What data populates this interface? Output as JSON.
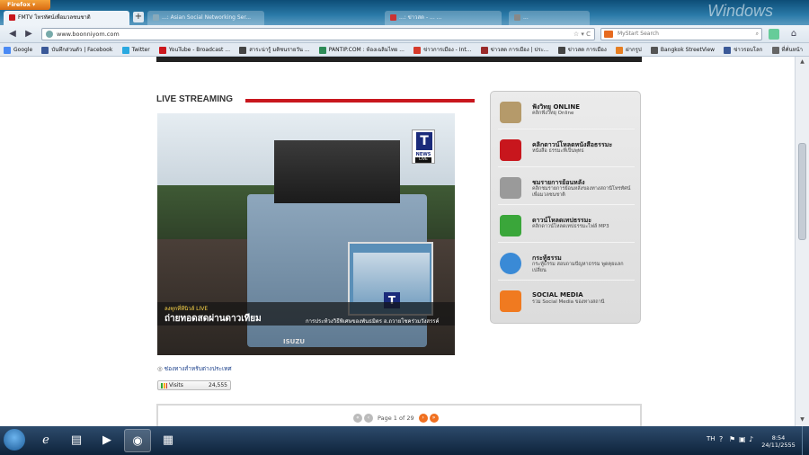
{
  "browser": {
    "menu_button": "Firefox",
    "tabs": [
      {
        "label": "FMTV โทรทัศน์เพื่อมวลชนชาติ",
        "active": true
      },
      {
        "label": "...: Asian Social Networking Ser...",
        "active": false
      },
      {
        "label": "...: ข่าวสด - ... ...",
        "active": false
      },
      {
        "label": "...",
        "active": false
      }
    ],
    "new_tab": "+",
    "url": "www.boonniyom.com",
    "search_placeholder": "MyStart Search",
    "os_watermark": "Windows"
  },
  "bookmarks": [
    {
      "label": "Google",
      "color": "#4a8af4"
    },
    {
      "label": "บันทึกส่วนตัว | Facebook",
      "color": "#3b5998"
    },
    {
      "label": "Twitter",
      "color": "#2aa9e0"
    },
    {
      "label": "YouTube - Broadcast ...",
      "color": "#cc181e"
    },
    {
      "label": "สาระน่ารู้ มติชนรายวัน ...",
      "color": "#444444"
    },
    {
      "label": "PANTIP.COM : ห้องเฉลิมไทย ...",
      "color": "#2e8b57"
    },
    {
      "label": "ข่าวการเมือง - Int...",
      "color": "#d63a2b"
    },
    {
      "label": "ข่าวสด การเมือง | ประ...",
      "color": "#9a2b2b"
    },
    {
      "label": "ข่าวสด การเมือง",
      "color": "#444444"
    },
    {
      "label": "ฝากรูป",
      "color": "#e67e22"
    },
    {
      "label": "Bangkok StreetView",
      "color": "#555555"
    },
    {
      "label": "ข่าวรอบโลก",
      "color": "#3b5998"
    },
    {
      "label": "ที่คั่นหน้า",
      "color": "#666666"
    }
  ],
  "main": {
    "section_title": "LIVE STREAMING",
    "video": {
      "badge_letter": "T",
      "badge_label": "NEWS",
      "badge_live": "LIVE",
      "caption_small": "ลงทุกที่ทีนิวส์ LIVE",
      "caption_main": "ถ่ายทอดสดผ่านดาวเทียม",
      "caption_right": "การประท้วงวิธีพิเศษของพันธมิตร อ.ถวายโชคร่วมวังสรรค์",
      "vehicle_text": "ISUZU"
    },
    "abroad_link": "ช่องทางสำหรับต่างประเทศ",
    "visits_label": "Visits",
    "visits_count": "24,555",
    "pager_text": "Page 1 of 29"
  },
  "sidebar": {
    "items": [
      {
        "title": "ฟังวิทยุ ONLINE",
        "subtitle": "คลิกฟังวิทยุ Online",
        "icon": "radio-icon",
        "color": "#b59a6a"
      },
      {
        "title": "คลิกดาวน์โหลดหนังสือธรรมะ",
        "subtitle": "หนังสือ ธรรมะที่เป็นพุทธ",
        "icon": "pdf-icon",
        "color": "#c8161d"
      },
      {
        "title": "ชมรายการย้อนหลัง",
        "subtitle": "คลิกชมรายการย้อนหลังของทางสถานีโทรทัศน์เพื่อมวลชนชาติ",
        "icon": "film-icon",
        "color": "#9a9a9a"
      },
      {
        "title": "ดาวน์โหลดเทปธรรมะ",
        "subtitle": "คลิกดาวน์โหลดเทปธรรมะไฟล์ MP3",
        "icon": "music-icon",
        "color": "#3aa63a"
      },
      {
        "title": "กระทู้ธรรม",
        "subtitle": "กระทู้ธรรม สอบถามปัญหาธรรม พูดคุยแลกเปลี่ยน",
        "icon": "chat-icon",
        "color": "#3a8ad6"
      },
      {
        "title": "SOCIAL MEDIA",
        "subtitle": "รวม Social Media ของทางสถานี",
        "icon": "rss-icon",
        "color": "#f07a20"
      }
    ]
  },
  "taskbar": {
    "language": "TH",
    "time": "8:54",
    "date": "24/11/2555"
  }
}
